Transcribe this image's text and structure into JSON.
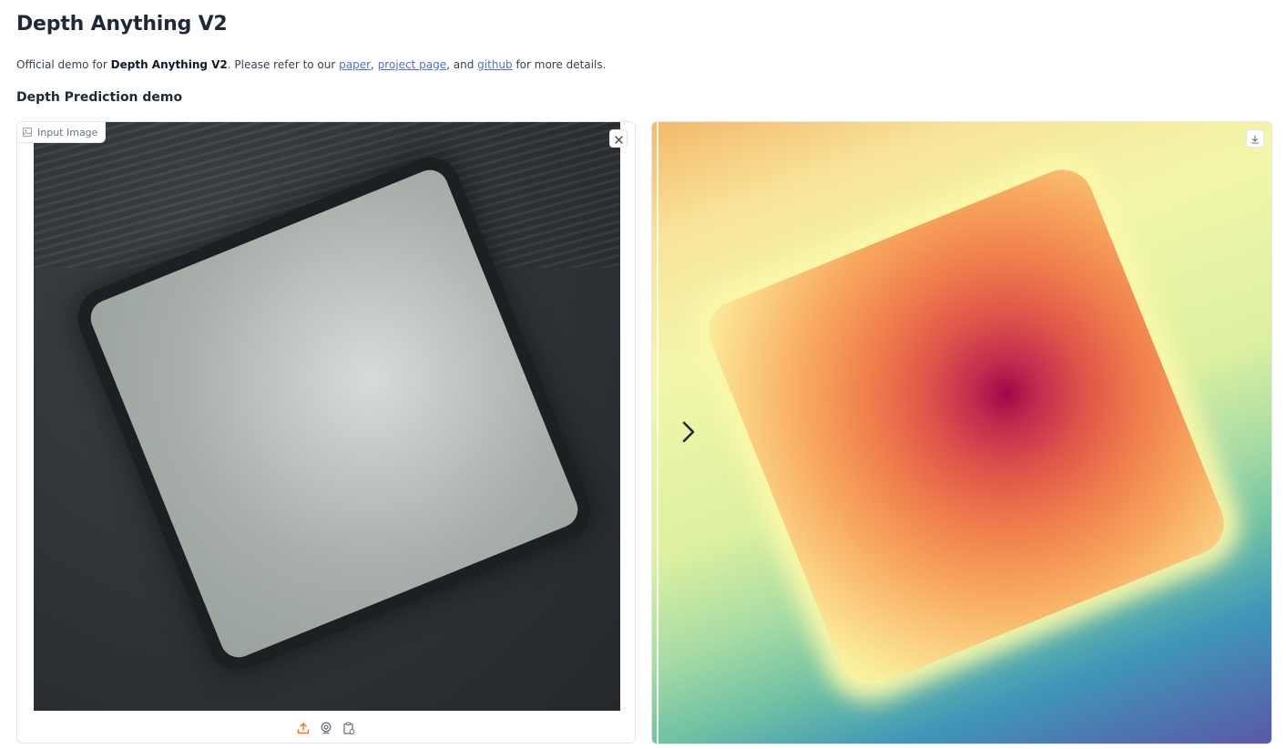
{
  "header": {
    "title": "Depth Anything V2"
  },
  "intro": {
    "prefix": "Official demo for ",
    "model_name": "Depth Anything V2",
    "mid": ". Please refer to our ",
    "paper_link": "paper",
    "sep1": ", ",
    "project_link": "project page",
    "sep2": ", and ",
    "github_link": "github",
    "suffix": " for more details."
  },
  "section": {
    "title": "Depth Prediction demo"
  },
  "input_panel": {
    "label": "Input Image",
    "label_icon": "image-icon",
    "clear_icon": "close-icon",
    "sources": [
      "upload-icon",
      "webcam-icon",
      "clipboard-icon"
    ],
    "upload_color": "#f97316"
  },
  "output_panel": {
    "download_icon": "download-icon",
    "slider_icon": "chevron-right-icon"
  }
}
